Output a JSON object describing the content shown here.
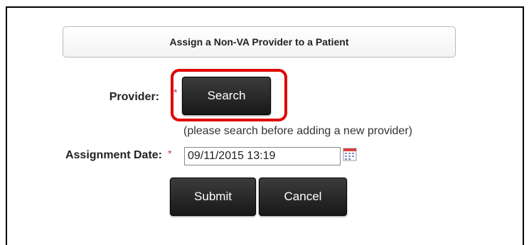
{
  "form": {
    "title": "Assign a Non-VA Provider to a Patient",
    "provider_label": "Provider:",
    "required_marker": "*",
    "search_button": "Search",
    "search_hint": "(please search before adding a new provider)",
    "assignment_date_label": "Assignment Date:",
    "assignment_date_value": "09/11/2015 13:19",
    "calendar_icon": "calendar-icon",
    "submit_button": "Submit",
    "cancel_button": "Cancel"
  },
  "colors": {
    "highlight": "#e00000",
    "required": "#c0392b",
    "button_bg": "#222222"
  }
}
